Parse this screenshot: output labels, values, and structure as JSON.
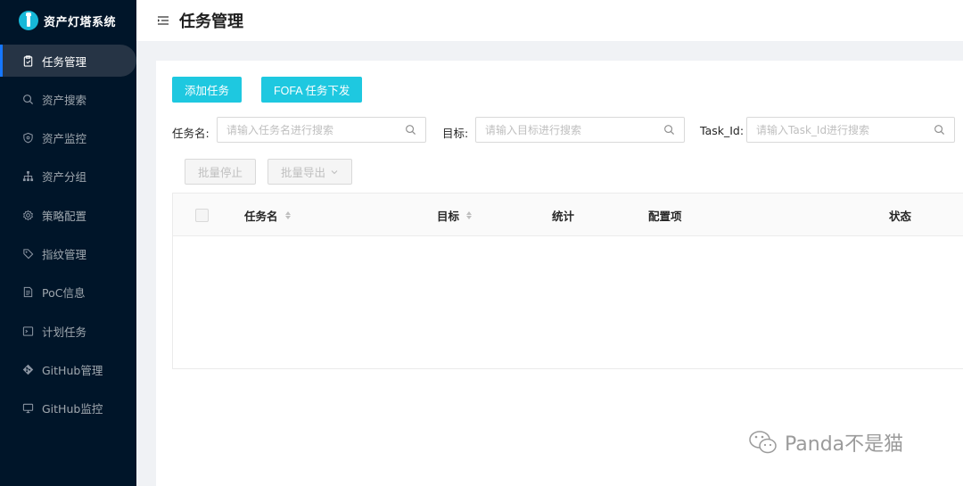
{
  "app": {
    "title": "资产灯塔系统"
  },
  "sidebar": {
    "items": [
      {
        "label": "任务管理",
        "icon": "clipboard-icon",
        "active": true
      },
      {
        "label": "资产搜索",
        "icon": "search-icon"
      },
      {
        "label": "资产监控",
        "icon": "shield-icon"
      },
      {
        "label": "资产分组",
        "icon": "hierarchy-icon"
      },
      {
        "label": "策略配置",
        "icon": "gear-icon"
      },
      {
        "label": "指纹管理",
        "icon": "tag-icon"
      },
      {
        "label": "PoC信息",
        "icon": "document-icon"
      },
      {
        "label": "计划任务",
        "icon": "terminal-icon"
      },
      {
        "label": "GitHub管理",
        "icon": "git-icon"
      },
      {
        "label": "GitHub监控",
        "icon": "monitor-icon"
      }
    ]
  },
  "header": {
    "title": "任务管理"
  },
  "toolbar": {
    "add_task": "添加任务",
    "fofa_task": "FOFA 任务下发",
    "batch_stop": "批量停止",
    "batch_export": "批量导出"
  },
  "filters": {
    "task_name": {
      "label": "任务名:",
      "placeholder": "请输入任务名进行搜索"
    },
    "target": {
      "label": "目标:",
      "placeholder": "请输入目标进行搜索"
    },
    "task_id": {
      "label": "Task_Id:",
      "placeholder": "请输入Task_Id进行搜索"
    }
  },
  "table": {
    "columns": [
      "任务名",
      "目标",
      "统计",
      "配置项",
      "状态"
    ]
  },
  "watermark": {
    "text": "Panda不是猫"
  }
}
